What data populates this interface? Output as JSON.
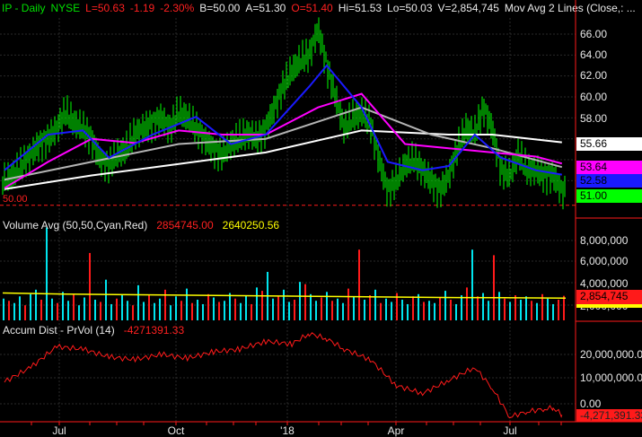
{
  "header": {
    "symbol": "IP - Daily",
    "exchange": "NYSE",
    "last": "L=50.63",
    "change": "-1.19",
    "change_pct": "-2.30%",
    "bid": "B=50.00",
    "ask": "A=51.30",
    "open": "O=51.40",
    "high": "Hi=51.53",
    "low": "Lo=50.03",
    "volume": "V=2,854,745",
    "study": "Mov Avg 2 Lines (Close,: ..."
  },
  "colors": {
    "up": "#00ff00",
    "ma_white": "#ffffff",
    "ma_grey": "#b4b4b4",
    "ma_magenta": "#ff00ff",
    "ma_blue": "#1a1aff",
    "vol_up": "#00e5ee",
    "vol_down": "#ff1a1a",
    "avg": "#ffff00",
    "accum": "#ff1a1a",
    "axis": "#ff1a1a"
  },
  "chart_data": [
    {
      "type": "line",
      "title": "IP - Daily NYSE",
      "x_unit": "week index (0 = mid-May 2017, 64 = mid-Aug 2018)",
      "ylim": [
        49,
        67.5
      ],
      "y_ticks": [
        "66.00",
        "64.00",
        "62.00",
        "60.00",
        "58.00"
      ],
      "reference_line": {
        "value": 50.0,
        "label": "50.00"
      },
      "closes": [
        52.0,
        52.5,
        53.5,
        54.5,
        55.5,
        56,
        57,
        58.5,
        57.5,
        57,
        56,
        54,
        53.5,
        54.5,
        55,
        56.5,
        57,
        57.5,
        58,
        57,
        58.5,
        58,
        57,
        56,
        55,
        54.5,
        55.5,
        56,
        56.5,
        56,
        57,
        59,
        61,
        62.5,
        63.5,
        64,
        66.5,
        63,
        60,
        57,
        58,
        58.5,
        57.5,
        54,
        51,
        52,
        53.5,
        54,
        53,
        52,
        51,
        52.5,
        55,
        57,
        56.5,
        59,
        57,
        53,
        52.5,
        54.5,
        53,
        53,
        52.5,
        52.5,
        51
      ],
      "series": [
        {
          "name": "MA white",
          "last_label": "55.66",
          "points": [
            [
              0,
              51.2
            ],
            [
              10,
              52.5
            ],
            [
              20,
              53.6
            ],
            [
              30,
              54.7
            ],
            [
              41,
              56.8
            ],
            [
              51,
              56.4
            ],
            [
              56,
              56.4
            ],
            [
              64,
              55.66
            ]
          ]
        },
        {
          "name": "MA grey",
          "last_label": "",
          "points": [
            [
              0,
              52.1
            ],
            [
              10,
              53.8
            ],
            [
              20,
              55.5
            ],
            [
              30,
              56
            ],
            [
              41,
              59
            ],
            [
              49,
              56.4
            ],
            [
              56,
              55.1
            ],
            [
              64,
              53.3
            ]
          ]
        },
        {
          "name": "MA magenta",
          "last_label": "53.64",
          "points": [
            [
              0,
              51.3
            ],
            [
              5,
              53.8
            ],
            [
              10,
              56
            ],
            [
              15,
              55.6
            ],
            [
              20,
              56.8
            ],
            [
              25,
              56.4
            ],
            [
              30,
              56.4
            ],
            [
              36,
              59
            ],
            [
              41,
              60.3
            ],
            [
              46,
              55.5
            ],
            [
              51,
              55.1
            ],
            [
              56,
              54.7
            ],
            [
              61,
              54.3
            ],
            [
              64,
              53.64
            ]
          ]
        },
        {
          "name": "MA blue",
          "last_label": "52.58",
          "points": [
            [
              0,
              53
            ],
            [
              5,
              56.4
            ],
            [
              9,
              56.8
            ],
            [
              12,
              54.2
            ],
            [
              17,
              56.4
            ],
            [
              22,
              58.1
            ],
            [
              26,
              55.5
            ],
            [
              30,
              56.4
            ],
            [
              35,
              61
            ],
            [
              37,
              63
            ],
            [
              41,
              59
            ],
            [
              44,
              53.8
            ],
            [
              48,
              53
            ],
            [
              51,
              53.4
            ],
            [
              54,
              56.4
            ],
            [
              57,
              54.2
            ],
            [
              61,
              53
            ],
            [
              64,
              52.58
            ]
          ]
        }
      ],
      "last_price_label": "51.00",
      "x_ticks": [
        "Jul",
        "Oct",
        "'18",
        "Apr",
        "Jul"
      ]
    },
    {
      "type": "bar",
      "title": "Volume Avg (50,50,Cyan,Red)",
      "value_label": "2854745.00",
      "avg_label": "2640250.56",
      "unit": "millions; positive = cyan (up), negative = red (down)",
      "y_ticks": [
        "8,000,000",
        "6,000,000",
        "4,000,000",
        "2,000,000"
      ],
      "last_label": "2,854,745",
      "values": [
        2.6,
        -2.4,
        2.2,
        2.8,
        -2.0,
        3.0,
        3.4,
        -2.5,
        9.0,
        2.6,
        -2.2,
        3.2,
        2.4,
        -3.0,
        2.0,
        2.7,
        -6.7,
        2.5,
        -2.3,
        4.3,
        2.1,
        -2.6,
        2.9,
        2.4,
        -2.0,
        3.8,
        2.3,
        -2.9,
        2.2,
        2.6,
        -3.4,
        2.0,
        2.8,
        -2.4,
        3.5,
        -2.2,
        2.5,
        2.1,
        -3.0,
        2.7,
        -2.3,
        2.4,
        3.1,
        -2.6,
        2.2,
        2.9,
        -2.1,
        3.6,
        -3.3,
        5.0,
        2.6,
        -2.8,
        3.4,
        2.3,
        -2.5,
        4.1,
        -3.9,
        3.0,
        2.4,
        -2.7,
        3.2,
        -2.4,
        2.6,
        2.2,
        -3.5,
        2.8,
        -7.0,
        2.5,
        -2.9,
        3.4,
        -2.2,
        2.6,
        2.3,
        -3.1,
        2.5,
        2.1,
        -2.8,
        3.0,
        -2.3,
        2.4,
        2.2,
        -2.7,
        3.3,
        -2.5,
        2.1,
        2.9,
        -3.6,
        7.0,
        -2.8,
        3.1,
        2.4,
        -6.5,
        3.2,
        -2.6,
        2.3,
        -2.9,
        2.5,
        2.8,
        -2.4,
        2.2,
        -3.0,
        2.6,
        2.1,
        -2.5,
        -2.85
      ],
      "avg_line": [
        3.1,
        3.0,
        2.95,
        2.9,
        2.85,
        2.8,
        2.75,
        2.7,
        2.68,
        2.64
      ]
    },
    {
      "type": "line",
      "title": "Accum Dist - PrVol (14)",
      "value_label": "-4271391.33",
      "y_ticks": [
        "20,000,000.00",
        "10,000,000.00",
        "0.00"
      ],
      "last_label": "-4,271,391.33",
      "unit": "millions",
      "points": [
        [
          0,
          8.5
        ],
        [
          3,
          14
        ],
        [
          6,
          22
        ],
        [
          9,
          21
        ],
        [
          12,
          18
        ],
        [
          15,
          17
        ],
        [
          18,
          19
        ],
        [
          21,
          17.5
        ],
        [
          24,
          20
        ],
        [
          27,
          21
        ],
        [
          30,
          24
        ],
        [
          33,
          23
        ],
        [
          35,
          27
        ],
        [
          37,
          25
        ],
        [
          39,
          21
        ],
        [
          42,
          17
        ],
        [
          45,
          7
        ],
        [
          48,
          4
        ],
        [
          51,
          9
        ],
        [
          54,
          14
        ],
        [
          56,
          6
        ],
        [
          58,
          -5
        ],
        [
          60,
          -3
        ],
        [
          62,
          -2
        ],
        [
          63,
          -1.5
        ],
        [
          64,
          -4.27
        ]
      ]
    }
  ]
}
